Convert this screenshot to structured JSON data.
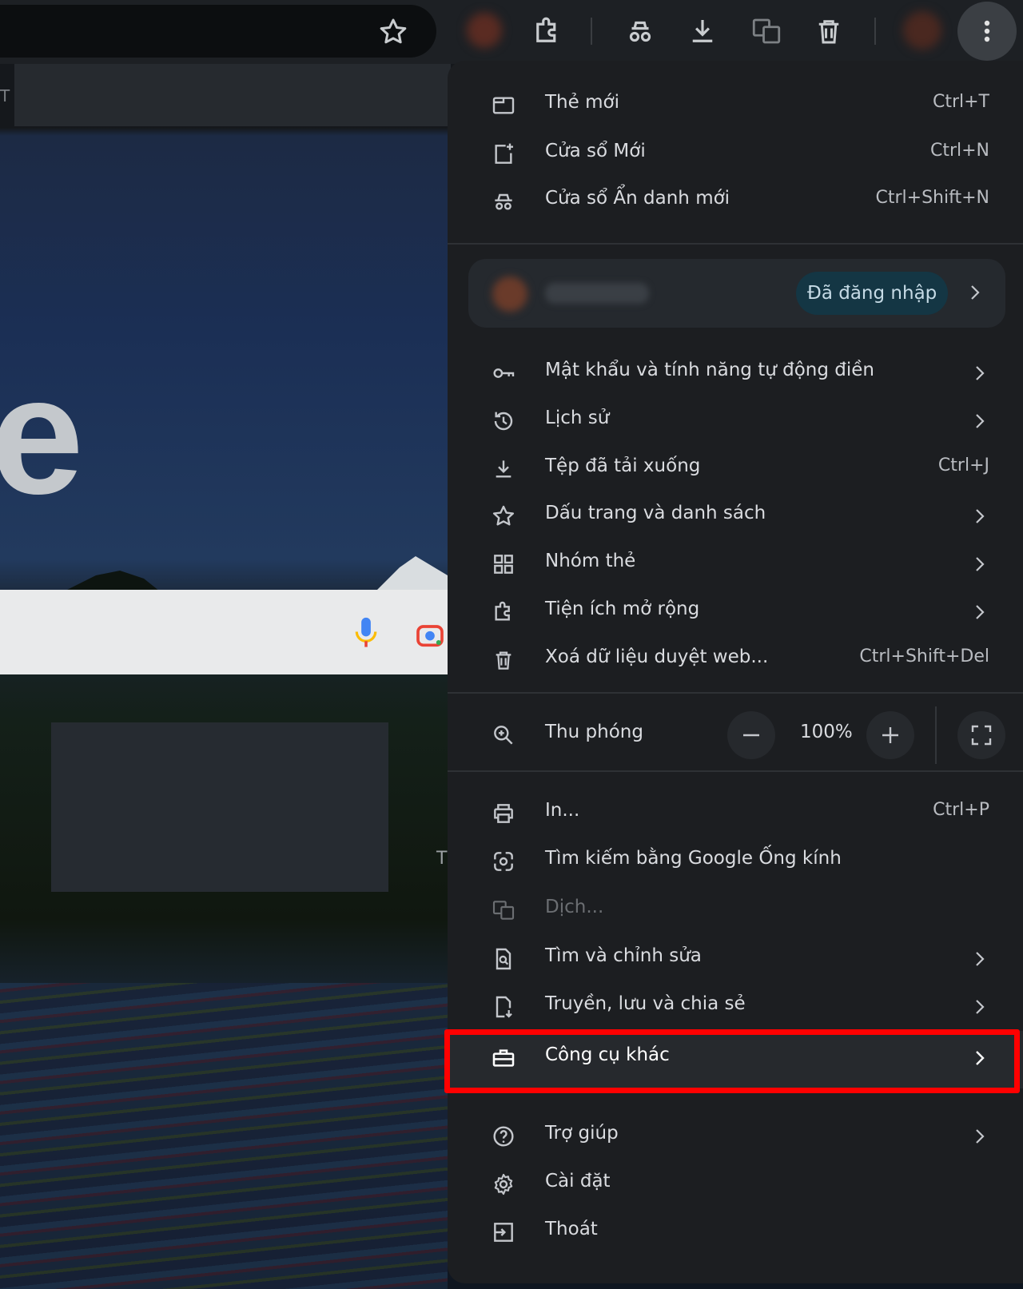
{
  "menu": {
    "new_tab": {
      "label": "Thẻ mới",
      "shortcut": "Ctrl+T",
      "icon": "new-tab-icon"
    },
    "new_window": {
      "label": "Cửa sổ Mới",
      "shortcut": "Ctrl+N",
      "icon": "new-window-icon"
    },
    "incognito": {
      "label": "Cửa sổ Ẩn danh mới",
      "shortcut": "Ctrl+Shift+N",
      "icon": "incognito-icon"
    },
    "profile": {
      "status": "Đã đăng nhập"
    },
    "passwords": {
      "label": "Mật khẩu và tính năng tự động điền",
      "icon": "key-icon"
    },
    "history": {
      "label": "Lịch sử",
      "icon": "history-icon"
    },
    "downloads": {
      "label": "Tệp đã tải xuống",
      "shortcut": "Ctrl+J",
      "icon": "download-icon"
    },
    "bookmarks": {
      "label": "Dấu trang và danh sách",
      "icon": "star-icon"
    },
    "tab_groups": {
      "label": "Nhóm thẻ",
      "icon": "grid-icon"
    },
    "extensions": {
      "label": "Tiện ích mở rộng",
      "icon": "puzzle-icon"
    },
    "clear_data": {
      "label": "Xoá dữ liệu duyệt web...",
      "shortcut": "Ctrl+Shift+Del",
      "icon": "trash-icon"
    },
    "zoom": {
      "label": "Thu phóng",
      "value": "100%",
      "minus": "−",
      "plus": "+",
      "icon": "zoom-icon"
    },
    "print": {
      "label": "In...",
      "shortcut": "Ctrl+P",
      "icon": "print-icon"
    },
    "lens": {
      "label": "Tìm kiếm bằng Google Ống kính",
      "icon": "lens-icon"
    },
    "translate": {
      "label": "Dịch...",
      "icon": "translate-icon",
      "disabled": true
    },
    "find_edit": {
      "label": "Tìm và chỉnh sửa",
      "icon": "find-page-icon"
    },
    "cast_save_share": {
      "label": "Truyền, lưu và chia sẻ",
      "icon": "cast-save-icon"
    },
    "more_tools": {
      "label": "Công cụ khác",
      "icon": "toolbox-icon",
      "highlighted": true
    },
    "help": {
      "label": "Trợ giúp",
      "icon": "help-icon"
    },
    "settings": {
      "label": "Cài đặt",
      "icon": "gear-icon"
    },
    "exit": {
      "label": "Thoát",
      "icon": "exit-icon"
    }
  },
  "background": {
    "tabstrip_fragment": "T",
    "logo_fragment": "e",
    "stray_text": "T"
  },
  "colors": {
    "menu_bg": "#1c1e21",
    "highlight": "#ff0000",
    "signed_in_badge": "#143644"
  }
}
